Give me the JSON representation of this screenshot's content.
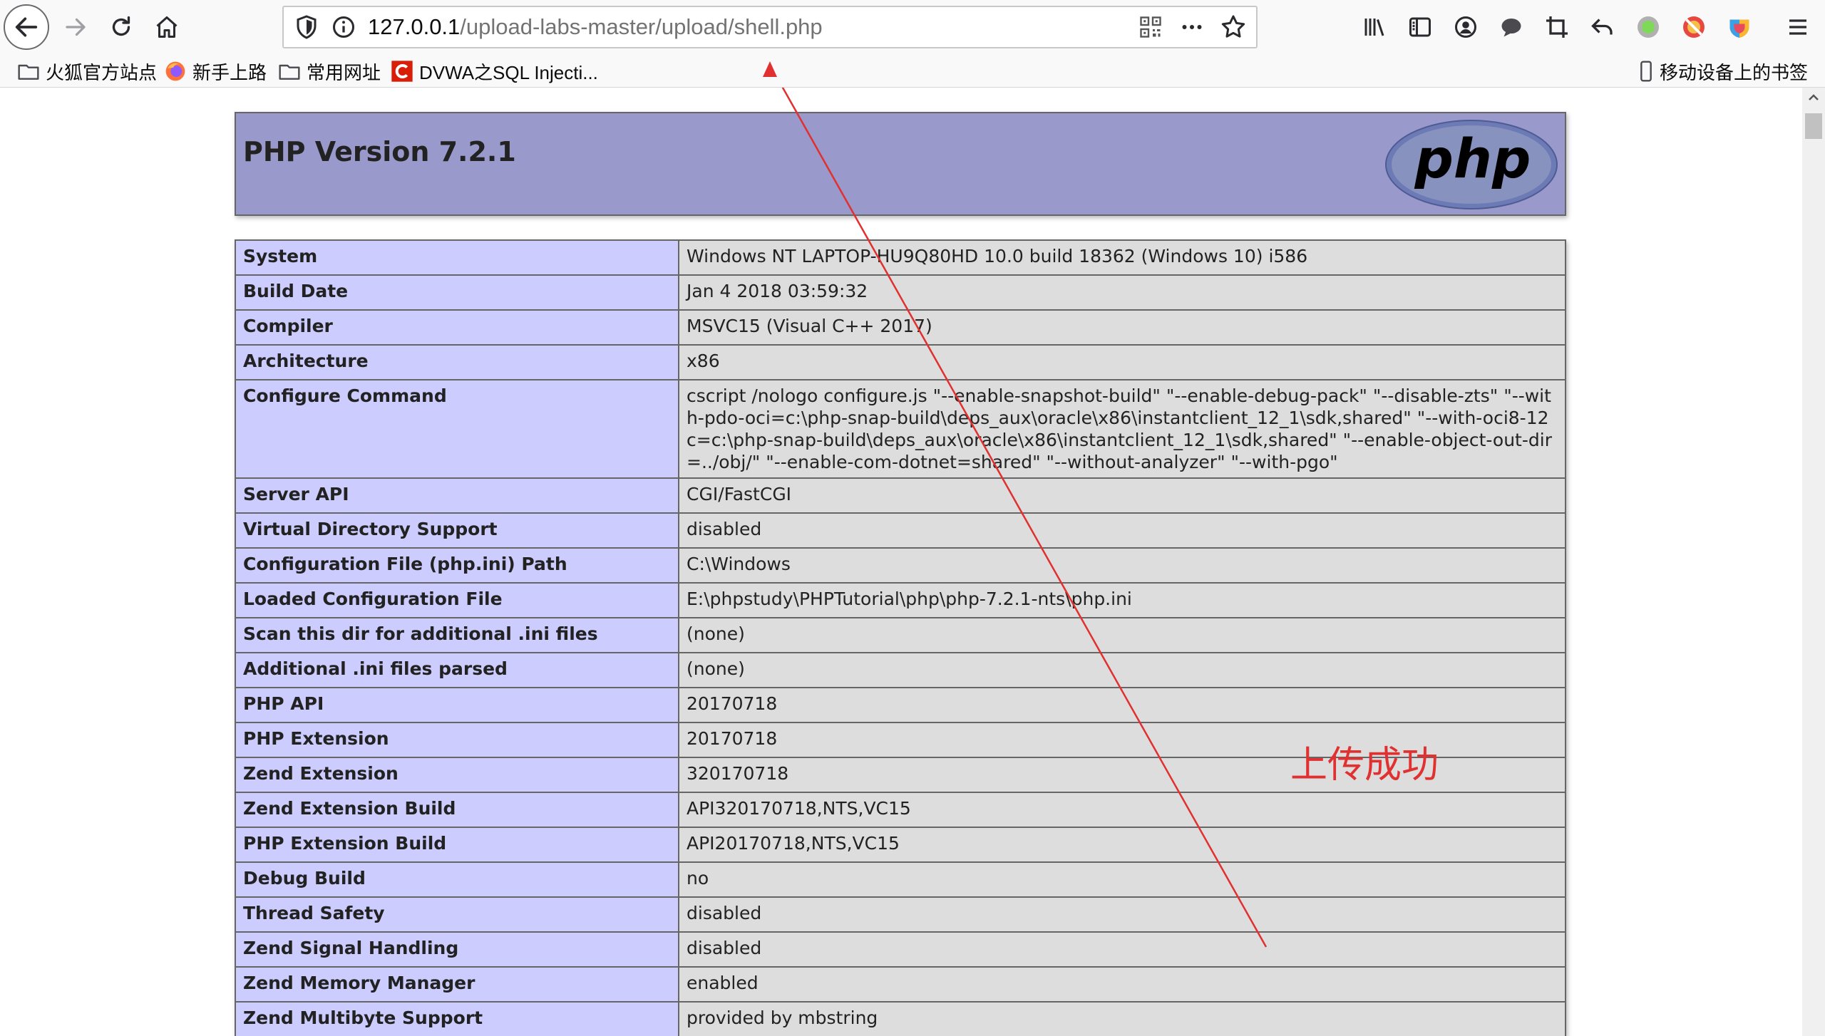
{
  "browser": {
    "url_host": "127.0.0.1",
    "url_path": "/upload-labs-master/upload/shell.php",
    "mobile_bookmarks_label": "移动设备上的书签",
    "icons": [
      "back-arrow-icon",
      "forward-arrow-icon",
      "reload-icon",
      "home-icon",
      "shield-icon",
      "info-icon",
      "qr-code-icon",
      "more-icon",
      "star-icon",
      "library-icon",
      "sidebar-icon",
      "account-icon",
      "chat-icon",
      "crop-icon",
      "undo-icon",
      "green-circle-icon",
      "no-entry-icon",
      "colorful-shield-icon",
      "menu-icon"
    ]
  },
  "bookmarks": [
    {
      "label": "火狐官方站点",
      "icon": "folder-icon"
    },
    {
      "label": "新手上路",
      "icon": "firefox-icon"
    },
    {
      "label": "常用网址",
      "icon": "folder-icon"
    },
    {
      "label": "DVWA之SQL Injecti...",
      "icon": "csdn-icon"
    }
  ],
  "php": {
    "title": "PHP Version 7.2.1",
    "logo_text": "php",
    "rows": [
      {
        "key": "System",
        "value": "Windows NT LAPTOP-HU9Q80HD 10.0 build 18362 (Windows 10) i586"
      },
      {
        "key": "Build Date",
        "value": "Jan 4 2018 03:59:32"
      },
      {
        "key": "Compiler",
        "value": "MSVC15 (Visual C++ 2017)"
      },
      {
        "key": "Architecture",
        "value": "x86"
      },
      {
        "key": "Configure Command",
        "value": "cscript /nologo configure.js \"--enable-snapshot-build\" \"--enable-debug-pack\" \"--disable-zts\" \"--with-pdo-oci=c:\\php-snap-build\\deps_aux\\oracle\\x86\\instantclient_12_1\\sdk,shared\" \"--with-oci8-12c=c:\\php-snap-build\\deps_aux\\oracle\\x86\\instantclient_12_1\\sdk,shared\" \"--enable-object-out-dir=../obj/\" \"--enable-com-dotnet=shared\" \"--without-analyzer\" \"--with-pgo\""
      },
      {
        "key": "Server API",
        "value": "CGI/FastCGI"
      },
      {
        "key": "Virtual Directory Support",
        "value": "disabled"
      },
      {
        "key": "Configuration File (php.ini) Path",
        "value": "C:\\Windows"
      },
      {
        "key": "Loaded Configuration File",
        "value": "E:\\phpstudy\\PHPTutorial\\php\\php-7.2.1-nts\\php.ini"
      },
      {
        "key": "Scan this dir for additional .ini files",
        "value": "(none)"
      },
      {
        "key": "Additional .ini files parsed",
        "value": "(none)"
      },
      {
        "key": "PHP API",
        "value": "20170718"
      },
      {
        "key": "PHP Extension",
        "value": "20170718"
      },
      {
        "key": "Zend Extension",
        "value": "320170718"
      },
      {
        "key": "Zend Extension Build",
        "value": "API320170718,NTS,VC15"
      },
      {
        "key": "PHP Extension Build",
        "value": "API20170718,NTS,VC15"
      },
      {
        "key": "Debug Build",
        "value": "no"
      },
      {
        "key": "Thread Safety",
        "value": "disabled"
      },
      {
        "key": "Zend Signal Handling",
        "value": "disabled"
      },
      {
        "key": "Zend Memory Manager",
        "value": "enabled"
      },
      {
        "key": "Zend Multibyte Support",
        "value": "provided by mbstring"
      }
    ]
  },
  "annotation": {
    "text": "上传成功",
    "color": "#e03030"
  },
  "colors": {
    "php_header_bg": "#9999cc",
    "key_cell_bg": "#ccccff",
    "value_cell_bg": "#dddddd"
  }
}
